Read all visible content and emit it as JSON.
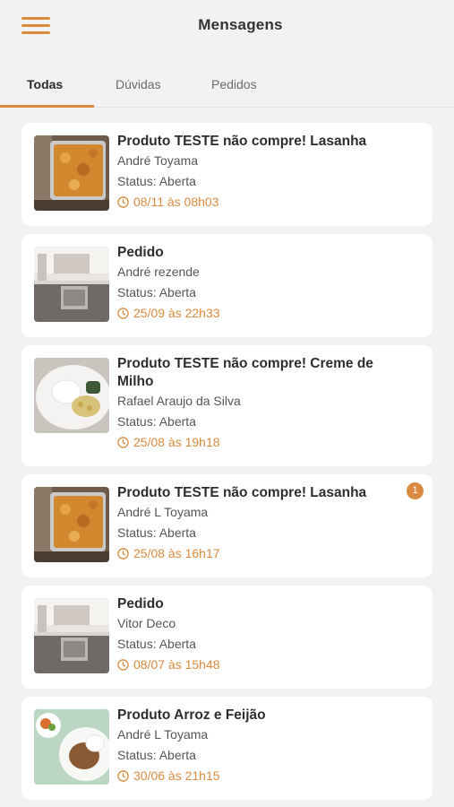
{
  "header": {
    "title": "Mensagens",
    "menu_icon": "hamburger-menu-icon"
  },
  "tabs": [
    {
      "label": "Todas",
      "active": true
    },
    {
      "label": "Dúvidas",
      "active": false
    },
    {
      "label": "Pedidos",
      "active": false
    }
  ],
  "colors": {
    "accent": "#d98a40",
    "background": "#f2f2f4",
    "card": "#ffffff"
  },
  "messages": [
    {
      "title": "Produto TESTE não compre! Lasanha",
      "author": "André Toyama",
      "status": "Status: Aberta",
      "date": "08/11 às 08h03",
      "thumb": "lasagna"
    },
    {
      "title": "Pedido",
      "author": "André rezende",
      "status": "Status: Aberta",
      "date": "25/09 às 22h33",
      "thumb": "kitchen"
    },
    {
      "title": "Produto TESTE não compre! Creme de Milho",
      "author": "Rafael Araujo da Silva",
      "status": "Status: Aberta",
      "date": "25/08 às 19h18",
      "thumb": "corn-cream"
    },
    {
      "title": "Produto TESTE não compre! Lasanha",
      "author": "André L Toyama",
      "status": "Status: Aberta",
      "date": "25/08 às 16h17",
      "thumb": "lasagna",
      "badge": "1"
    },
    {
      "title": "Pedido",
      "author": "Vitor Deco",
      "status": "Status: Aberta",
      "date": "08/07 às 15h48",
      "thumb": "kitchen"
    },
    {
      "title": "Produto Arroz e Feijão",
      "author": "André L Toyama",
      "status": "Status: Aberta",
      "date": "30/06 às 21h15",
      "thumb": "rice-beans"
    }
  ]
}
